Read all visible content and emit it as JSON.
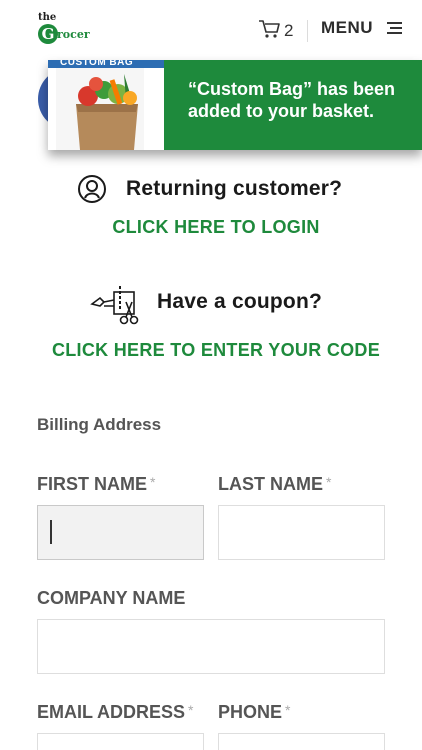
{
  "header": {
    "logo": {
      "small": "the",
      "initial": "G",
      "word": "rocer"
    },
    "cart_count": "2",
    "menu_label": "MENU",
    "icons": {
      "cart": "cart-icon",
      "menu": "hamburger-menu-icon"
    }
  },
  "notice": {
    "image_banner": "CUSTOM BAG",
    "message": "“Custom Bag” has been added to your basket.",
    "colors": {
      "background": "#1e8a3c",
      "banner": "#2d6db3"
    }
  },
  "returning": {
    "title": "Returning customer?",
    "link": "CLICK HERE TO LOGIN",
    "icon": "user-icon"
  },
  "coupon": {
    "title": "Have a coupon?",
    "link": "CLICK HERE TO ENTER YOUR CODE",
    "icon": "scissors-coupon-icon"
  },
  "billing": {
    "title": "Billing Address",
    "fields": {
      "first_name": {
        "label": "FIRST NAME",
        "required": "*",
        "value": ""
      },
      "last_name": {
        "label": "LAST NAME",
        "required": "*",
        "value": ""
      },
      "company": {
        "label": "COMPANY NAME",
        "value": ""
      },
      "email": {
        "label": "EMAIL ADDRESS",
        "required": "*",
        "value": ""
      },
      "phone": {
        "label": "PHONE",
        "required": "*",
        "value": ""
      }
    }
  },
  "colors": {
    "accent": "#1e8a3c",
    "label": "#555555"
  }
}
